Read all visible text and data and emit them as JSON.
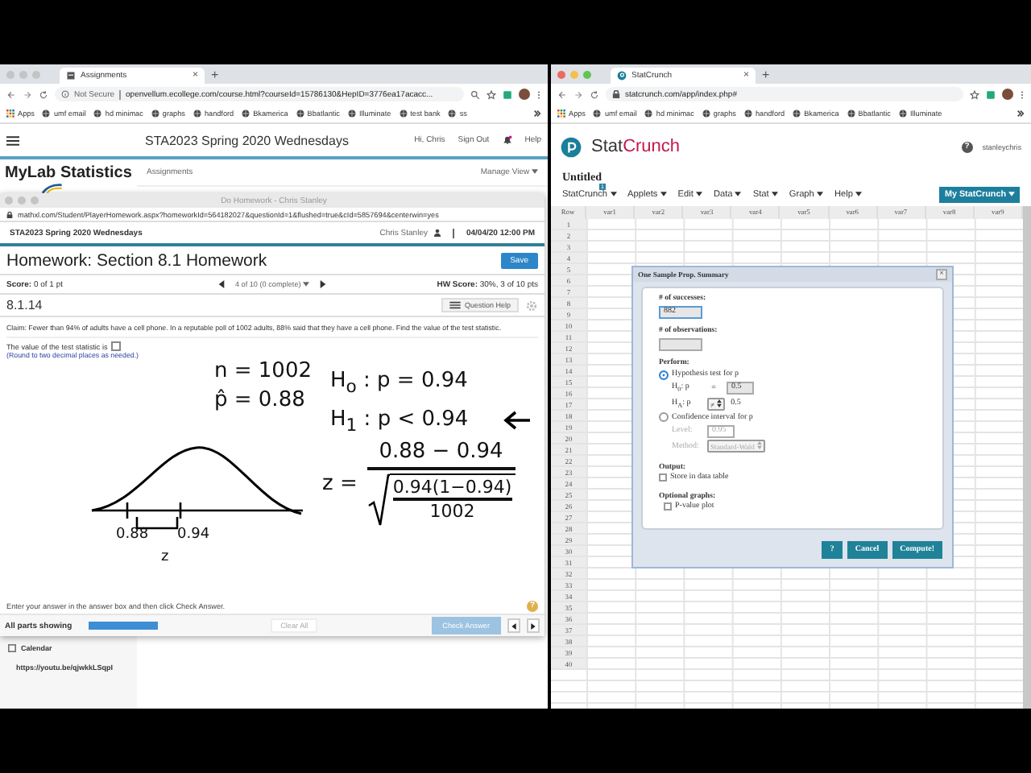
{
  "left_browser": {
    "tab": {
      "title": "Assignments",
      "close": "×"
    },
    "new_tab": "+",
    "address": {
      "security": "Not Secure",
      "url": "openvellum.ecollege.com/course.html?courseId=15786130&HepID=3776ea17acacc..."
    },
    "bookmarks": [
      "Apps",
      "umf email",
      "hd minimac",
      "graphs",
      "handford",
      "Bkamerica",
      "Bbatlantic",
      "Illuminate",
      "test bank",
      "ss"
    ],
    "header": {
      "course": "STA2023 Spring 2020 Wednesdays",
      "user": "Hi, Chris",
      "sign_out": "Sign Out",
      "help": "Help"
    },
    "brand": "MyLab Statistics",
    "nav": "Assignments",
    "manage": "Manage View",
    "sidebar": {
      "calendar": "Calendar",
      "link": "https://youtu.be/qjwkkLSqpI"
    },
    "popup": {
      "title": "Do Homework - Chris Stanley",
      "url": "mathxl.com/Student/PlayerHomework.aspx?homeworkId=564182027&questionId=1&flushed=true&cId=5857694&centerwin=yes",
      "course": "STA2023 Spring 2020 Wednesdays",
      "student": "Chris Stanley",
      "due": "04/04/20 12:00 PM",
      "heading": "Homework: Section 8.1 Homework",
      "save": "Save",
      "score": "**Score:** 0 of 1 pt",
      "pager": "4 of 10 (0 complete)",
      "hw_score": "**HW Score:** 30%, 3 of 10 pts",
      "question_id": "8.1.14",
      "question_help": "Question Help",
      "claim": "Claim: Fewer than 94% of adults have a cell phone. In a reputable poll of 1002 adults, 88% said that they have a cell phone. Find the value of the test statistic.",
      "prompt": "The value of the test statistic is",
      "hint": "(Round to two decimal places as needed.)",
      "annotations": {
        "n": "n = 1002",
        "p_hat": "p̂ = 0.88",
        "h0": "H$_{o}$ : p = 0.94",
        "h1": "H$_{1}$ : p < 0.94",
        "z_label": "z =",
        "numerator": "0.88 − 0.94",
        "radicand": "0.94(1−0.94)",
        "denominator": "1002",
        "curve_labels": [
          "0.88",
          "0.94",
          "z"
        ]
      },
      "instruction": "Enter your answer in the answer box and then click Check Answer.",
      "help_mark": "?",
      "parts": "All parts showing",
      "progress": {
        "level": 1
      },
      "clear": "Clear All",
      "check": {
        "label": "Check Answer",
        "disabled": true
      }
    }
  },
  "right_browser": {
    "tab": {
      "title": "StatCrunch",
      "close": "×"
    },
    "new_tab": "+",
    "url": "statcrunch.com/app/index.php#",
    "bookmarks": [
      "Apps",
      "umf email",
      "hd minimac",
      "graphs",
      "handford",
      "Bkamerica",
      "Bbatlantic",
      "Illuminate"
    ],
    "logo": {
      "first": "Stat",
      "second": "Crunch"
    },
    "help_mark": "?",
    "user": "stanleychris",
    "doc_title": "Untitled",
    "menus": [
      {
        "label": "StatCrunch",
        "badge": "1"
      },
      {
        "label": "Applets"
      },
      {
        "label": "Edit"
      },
      {
        "label": "Data"
      },
      {
        "label": "Stat"
      },
      {
        "label": "Graph"
      },
      {
        "label": "Help"
      }
    ],
    "my_button": "My StatCrunch",
    "grid": {
      "row_header": "Row",
      "columns": [
        "var1",
        "var2",
        "var3",
        "var4",
        "var5",
        "var6",
        "var7",
        "var8",
        "var9"
      ],
      "rows": [
        "1",
        "2",
        "3",
        "4",
        "5",
        "6",
        "7",
        "8",
        "9",
        "10",
        "11",
        "12",
        "13",
        "14",
        "15",
        "16",
        "17",
        "18",
        "19",
        "20",
        "21",
        "22",
        "23",
        "24",
        "25",
        "26",
        "27",
        "28",
        "29",
        "30",
        "31",
        "32",
        "33",
        "34",
        "35",
        "36",
        "37",
        "38",
        "39",
        "40"
      ]
    },
    "dialog": {
      "title": "One Sample Prop. Summary",
      "close": "×",
      "successes_label": "# of successes:",
      "successes": "882",
      "observations_label": "# of observations:",
      "perform_label": "Perform:",
      "options": [
        {
          "kind": "test",
          "label": "Hypothesis test for p",
          "selected": true
        },
        {
          "kind": "interval",
          "label": "Confidence interval for p",
          "selected": false
        }
      ],
      "h0": {
        "label": "H$_{0}$: p",
        "op": "=",
        "value": "0.5"
      },
      "ha": {
        "label": "H$_{A}$: p",
        "op": "≠",
        "value": "0.5"
      },
      "level": {
        "label": "Level:",
        "value": "0.95"
      },
      "method": {
        "label": "Method:",
        "value": "Standard-Wald"
      },
      "output_label": "Output:",
      "store": {
        "label": "Store in data table",
        "checked": false
      },
      "graphs_label": "Optional graphs:",
      "pvalue": {
        "label": "P-value plot",
        "checked": false
      },
      "buttons": [
        "?",
        "Cancel",
        "Compute!"
      ]
    }
  }
}
